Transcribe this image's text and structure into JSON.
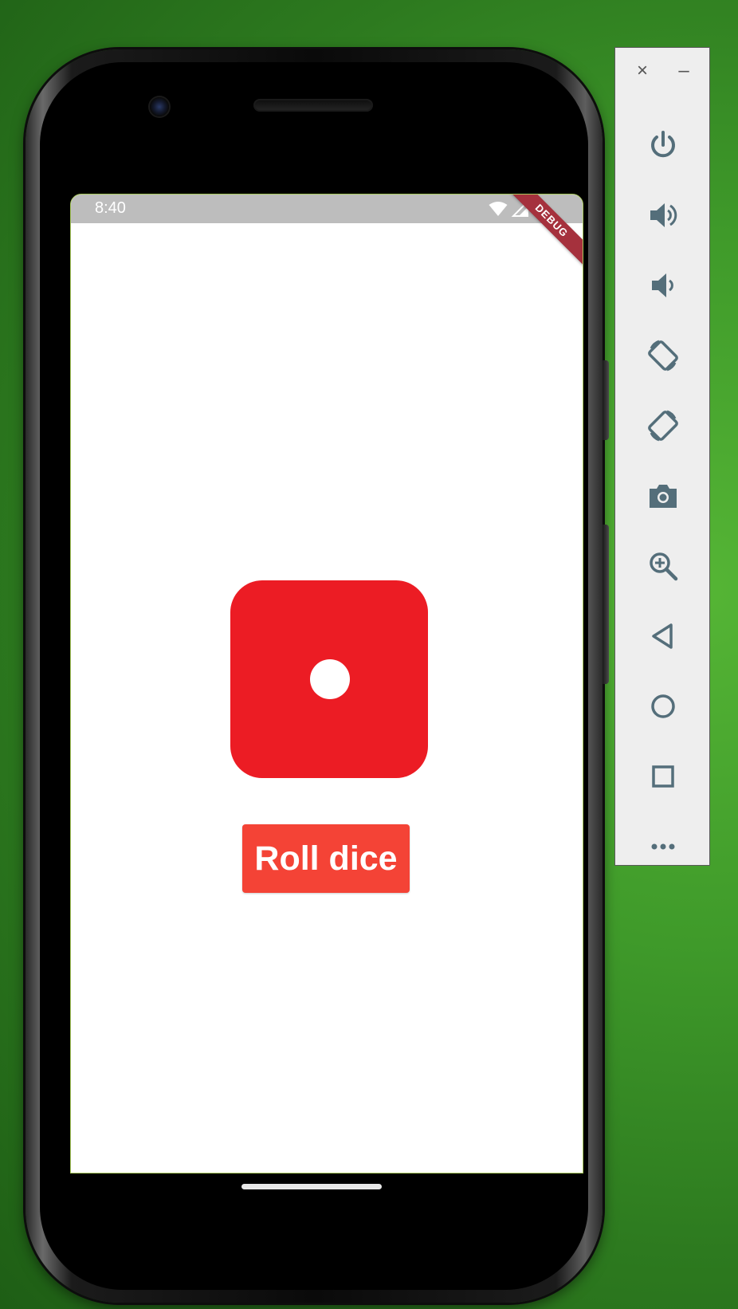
{
  "status_bar": {
    "time": "8:40",
    "debug_banner": "DEBUG"
  },
  "app": {
    "roll_button_label": "Roll dice",
    "dice_value": 1,
    "dice_color": "#ec1c24",
    "button_color": "#f44336"
  },
  "emulator_toolbar": {
    "close_glyph": "×",
    "minimize_glyph": "–",
    "buttons": [
      {
        "icon": "power-icon"
      },
      {
        "icon": "volume-up-icon"
      },
      {
        "icon": "volume-down-icon"
      },
      {
        "icon": "rotate-left-icon"
      },
      {
        "icon": "rotate-right-icon"
      },
      {
        "icon": "camera-icon"
      },
      {
        "icon": "zoom-icon"
      },
      {
        "icon": "back-icon"
      },
      {
        "icon": "home-icon"
      },
      {
        "icon": "overview-icon"
      },
      {
        "icon": "more-icon"
      }
    ],
    "icon_color": "#546e7a"
  }
}
